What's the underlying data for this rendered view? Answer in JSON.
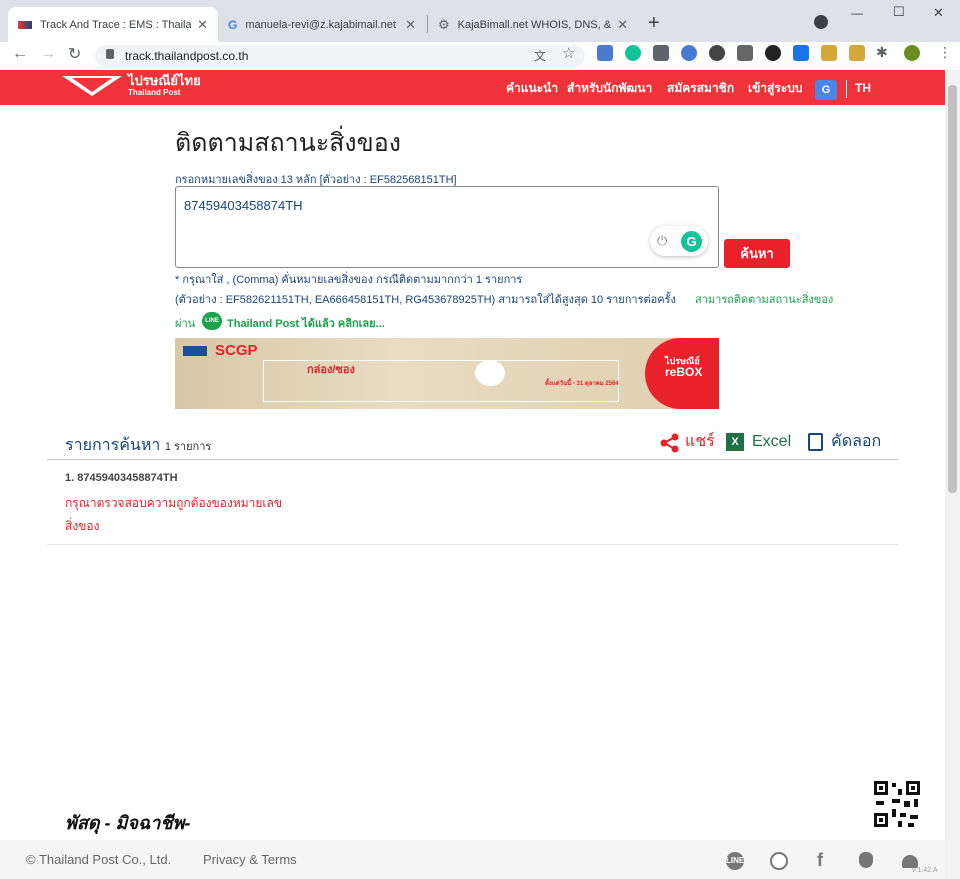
{
  "browser": {
    "tabs": [
      {
        "title": "Track And Trace : EMS : Thailand",
        "active": true
      },
      {
        "title": "manuela-revi@z.kajabimail.net -",
        "active": false
      },
      {
        "title": "KajaBimall.net WHOIS, DNS, & D",
        "active": false
      }
    ],
    "new_tab": "+",
    "url": "track.thailandpost.co.th",
    "window": {
      "minimize": "—",
      "maximize": "☐",
      "close": "✕"
    }
  },
  "site": {
    "logo_thai": "ไปรษณีย์ไทย",
    "logo_en": "Thailand Post",
    "nav": [
      "คำแนะนำ",
      "สำหรับนักพัฒนา",
      "สมัครสมาชิก",
      "เข้าสู่ระบบ"
    ],
    "translate_badge": "G",
    "lang": "TH",
    "accent": "#f0333a"
  },
  "main": {
    "title": "ติดตามสถานะสิ่งของ",
    "hint": "กรอกหมายเลขสิ่งของ 13 หลัก [ตัวอย่าง : EF582568151TH]",
    "tracking_value": "87459403458874TH",
    "search_button": "ค้นหา",
    "note1": "* กรุณาใส่ , (Comma) คั่นหมายเลขสิ่งของ กรณีติดตามมากกว่า 1 รายการ",
    "note2": "(ตัวอย่าง : EF582621151TH, EA666458151TH, RG453678925TH) สามารถใส่ได้สูงสุด 10 รายการต่อครั้ง",
    "note2_green": "สามารถติดตามสถานะสิ่งของ",
    "note3_prefix": "ผ่าน",
    "line_badge": "LINE",
    "note3_green": "Thailand Post ได้แล้ว คลิกเลย..."
  },
  "banner": {
    "brand": "SCGP",
    "small_brand": "ไปรษณีย์",
    "rebox": "reBOX",
    "headline": "กล่อง/ซอง",
    "date_text": "ตั้งแต่วันนี้ - 31 ตุลาคม 2564"
  },
  "results": {
    "title": "รายการค้นหา",
    "count": "1 รายการ",
    "share": "แชร์",
    "excel": "Excel",
    "copy": "คัดลอก",
    "items": [
      {
        "number": "1. 87459403458874TH",
        "error_line1": "กรุณาตรวจสอบความถูกต้องของหมายเลข",
        "error_line2": "สิ่งของ"
      }
    ]
  },
  "footer": {
    "signature": "พัสดุ - มิจฉาชีพ-",
    "copyright": "© Thailand Post Co., Ltd.",
    "privacy": "Privacy & Terms",
    "icons": [
      "line-icon",
      "globe-icon",
      "facebook-icon",
      "apple-icon",
      "android-icon"
    ],
    "version": "v 1.42.A"
  }
}
